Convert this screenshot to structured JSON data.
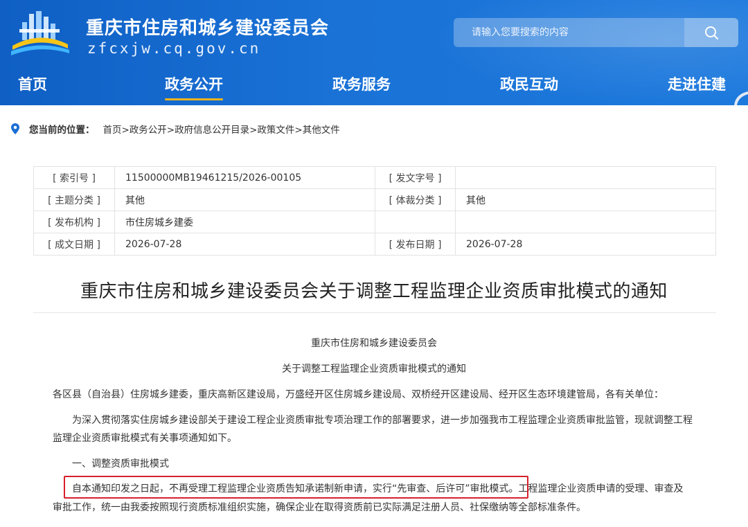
{
  "header": {
    "site_title": "重庆市住房和城乡建设委员会",
    "site_domain": "zfcxjw.cq.gov.cn",
    "search_placeholder": "请输入您要搜索的内容",
    "logo_icon": "building-emblem-icon",
    "search_icon": "search-icon"
  },
  "nav": {
    "items": [
      {
        "label": "首页"
      },
      {
        "label": "政务公开",
        "active": true
      },
      {
        "label": "政务服务"
      },
      {
        "label": "政民互动"
      },
      {
        "label": "走进住建"
      }
    ],
    "accent_color": "#f2b31b"
  },
  "breadcrumb": {
    "lead": "您当前的位置：",
    "path": "首页>政务公开>政府信息公开目录>政策文件>其他文件"
  },
  "meta": {
    "rows": [
      {
        "k1": "[ 索引号 ]",
        "v1": "11500000MB19461215/2026-00105",
        "k2": "[ 发文字号 ]",
        "v2": ""
      },
      {
        "k1": "[ 主题分类 ]",
        "v1": "其他",
        "k2": "[ 体裁分类 ]",
        "v2": "其他"
      },
      {
        "k1": "[ 发布机构 ]",
        "v1": "市住房城乡建委",
        "k2": "",
        "v2": ""
      },
      {
        "k1": "[ 成文日期 ]",
        "v1": "2026-07-28",
        "k2": "[ 发布日期 ]",
        "v2": "2026-07-28"
      }
    ]
  },
  "article": {
    "title": "重庆市住房和城乡建设委员会关于调整工程监理企业资质审批模式的通知",
    "issuer": "重庆市住房和城乡建设委员会",
    "subtitle": "关于调整工程监理企业资质审批模式的通知",
    "addressees": "各区县（自治县）住房城乡建委，重庆高新区建设局，万盛经开区住房城乡建设局、双桥经开区建设局、经开区生态环境建管局，各有关单位：",
    "intro_line1": "为深入贯彻落实住房城乡建设部关于建设工程企业资质审批专项治理工作的部署要求，进一步加强我市工程监理企业资质审批监管，现就调整工程",
    "intro_line2": "监理企业资质审批模式有关事项通知如下。",
    "section1": "一、调整资质审批模式",
    "para1_line1": "自本通知印发之日起，不再受理工程监理企业资质告知承诺制新申请，实行“先审查、后许可”审批模式。工程监理企业资质申请的受理、审查及",
    "para1_line2": "审批工作，统一由我委按照现行资质标准组织实施，确保企业在取得资质前已实际满足注册人员、社保缴纳等全部标准条件。",
    "highlight_color": "#d6202c"
  }
}
